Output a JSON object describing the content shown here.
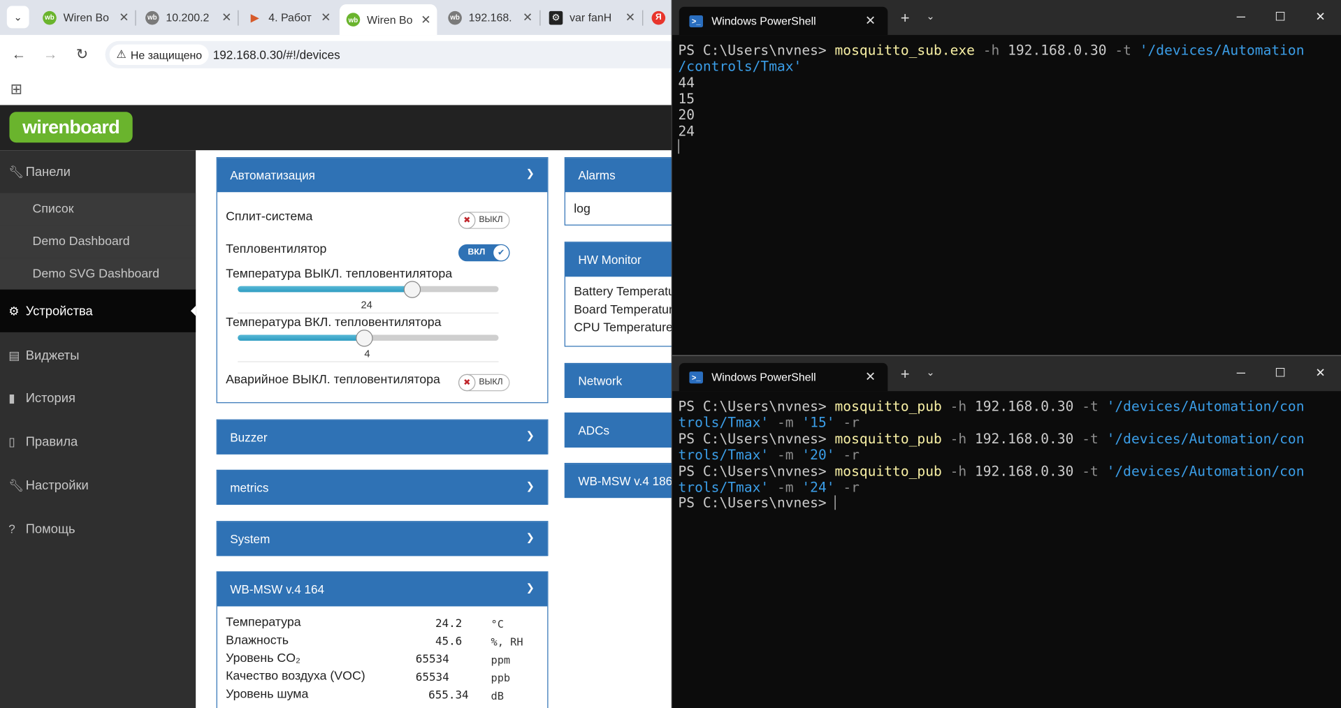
{
  "browser": {
    "tabs": [
      {
        "title": "Wiren Bo",
        "favicon": "wb",
        "color": "#6ab42d"
      },
      {
        "title": "10.200.2",
        "favicon": "wb",
        "color": "#7a7a7a"
      },
      {
        "title": "4. Работ",
        "favicon": "play",
        "color": "#d65a2a"
      },
      {
        "title": "Wiren Bo",
        "favicon": "wb",
        "color": "#6ab42d"
      },
      {
        "title": "192.168.",
        "favicon": "wb",
        "color": "#7a7a7a"
      },
      {
        "title": "var fanH",
        "favicon": "gear",
        "color": "#222"
      },
      {
        "title": "Я",
        "favicon": "ya",
        "color": "#e8352c"
      }
    ],
    "security_label": "Не защищено",
    "url": "192.168.0.30/#!/devices"
  },
  "sidebar": {
    "logo": "wirenboard",
    "items": [
      {
        "label": "Панели",
        "icon": "wrench-icon"
      },
      {
        "label": "Список"
      },
      {
        "label": "Demo Dashboard"
      },
      {
        "label": "Demo SVG Dashboard"
      },
      {
        "label": "Устройства",
        "icon": "gear-icon"
      },
      {
        "label": "Виджеты",
        "icon": "list-icon"
      },
      {
        "label": "История",
        "icon": "bar-chart-icon"
      },
      {
        "label": "Правила",
        "icon": "document-icon"
      },
      {
        "label": "Настройки",
        "icon": "wrench-icon"
      },
      {
        "label": "Помощь",
        "icon": "help-icon"
      }
    ]
  },
  "automation": {
    "title": "Автоматизация",
    "split_label": "Сплит-система",
    "split_state": "ВЫКЛ",
    "heater_label": "Тепловентилятор",
    "heater_state": "ВКЛ",
    "temp_off_label": "Температура ВЫКЛ. тепловентилятора",
    "temp_off_value": "24",
    "temp_off_fraction": 0.67,
    "temp_on_label": "Температура ВКЛ. тепловентилятора",
    "temp_on_value": "4",
    "temp_on_fraction": 0.485,
    "emergency_label": "Аварийное ВЫКЛ. тепловентилятора",
    "emergency_state": "ВЫКЛ"
  },
  "panels": {
    "buzzer": "Buzzer",
    "metrics": "metrics",
    "system": "System",
    "msw164": "WB-MSW v.4 164",
    "alarms": "Alarms",
    "alarms_log": "log",
    "hw": "HW Monitor",
    "hw_rows": [
      "Battery Temperature",
      "Board Temperature",
      "CPU Temperature"
    ],
    "network": "Network",
    "adcs": "ADCs",
    "msw186": "WB-MSW v.4 186"
  },
  "msw164_rows": [
    {
      "label": "Температура",
      "value": "24.2",
      "unit": "°C"
    },
    {
      "label": "Влажность",
      "value": "45.6",
      "unit": "%, RH"
    },
    {
      "label": "Уровень CO₂",
      "value": "65534",
      "unit": "ppm"
    },
    {
      "label": "Качество воздуха (VOC)",
      "value": "65534",
      "unit": "ppb"
    },
    {
      "label": "Уровень шума",
      "value": "655.34",
      "unit": "dB"
    }
  ],
  "terminal1": {
    "title": "Windows PowerShell",
    "prompt": "PS C:\\Users\\nvnes> ",
    "cmd": "mosquitto_sub.exe",
    "arg_h": "-h",
    "host": " 192.168.0.30 ",
    "arg_t": "-t",
    "topic_part1": " '/devices/Automation",
    "topic_part2": "/controls/Tmax'",
    "outputs": [
      "44",
      "15",
      "20",
      "24"
    ]
  },
  "terminal2": {
    "title": "Windows PowerShell",
    "prompt": "PS C:\\Users\\nvnes> ",
    "cmd": "mosquitto_pub",
    "arg_h": "-h",
    "host": " 192.168.0.30 ",
    "arg_t": "-t",
    "topic_part1": " '/devices/Automation/con",
    "topic_part2": "trols/Tmax'",
    "arg_m": "-m",
    "arg_r": "-r",
    "messages": [
      "'15'",
      "'20'",
      "'24'"
    ]
  }
}
